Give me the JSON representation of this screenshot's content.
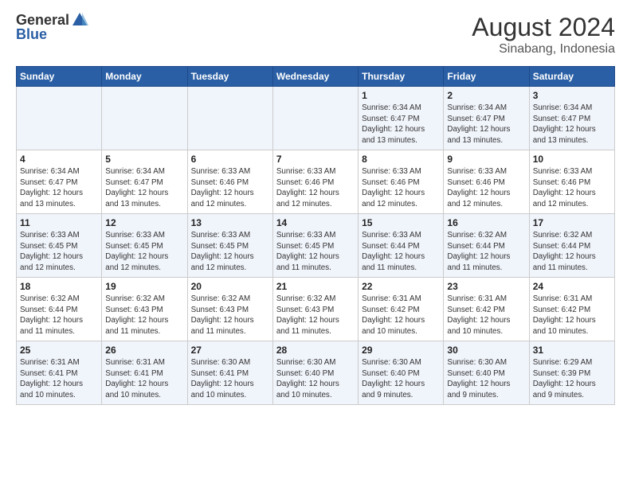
{
  "header": {
    "logo_general": "General",
    "logo_blue": "Blue",
    "month_year": "August 2024",
    "location": "Sinabang, Indonesia"
  },
  "days_of_week": [
    "Sunday",
    "Monday",
    "Tuesday",
    "Wednesday",
    "Thursday",
    "Friday",
    "Saturday"
  ],
  "weeks": [
    [
      {
        "day": "",
        "info": ""
      },
      {
        "day": "",
        "info": ""
      },
      {
        "day": "",
        "info": ""
      },
      {
        "day": "",
        "info": ""
      },
      {
        "day": "1",
        "info": "Sunrise: 6:34 AM\nSunset: 6:47 PM\nDaylight: 12 hours\nand 13 minutes."
      },
      {
        "day": "2",
        "info": "Sunrise: 6:34 AM\nSunset: 6:47 PM\nDaylight: 12 hours\nand 13 minutes."
      },
      {
        "day": "3",
        "info": "Sunrise: 6:34 AM\nSunset: 6:47 PM\nDaylight: 12 hours\nand 13 minutes."
      }
    ],
    [
      {
        "day": "4",
        "info": "Sunrise: 6:34 AM\nSunset: 6:47 PM\nDaylight: 12 hours\nand 13 minutes."
      },
      {
        "day": "5",
        "info": "Sunrise: 6:34 AM\nSunset: 6:47 PM\nDaylight: 12 hours\nand 13 minutes."
      },
      {
        "day": "6",
        "info": "Sunrise: 6:33 AM\nSunset: 6:46 PM\nDaylight: 12 hours\nand 12 minutes."
      },
      {
        "day": "7",
        "info": "Sunrise: 6:33 AM\nSunset: 6:46 PM\nDaylight: 12 hours\nand 12 minutes."
      },
      {
        "day": "8",
        "info": "Sunrise: 6:33 AM\nSunset: 6:46 PM\nDaylight: 12 hours\nand 12 minutes."
      },
      {
        "day": "9",
        "info": "Sunrise: 6:33 AM\nSunset: 6:46 PM\nDaylight: 12 hours\nand 12 minutes."
      },
      {
        "day": "10",
        "info": "Sunrise: 6:33 AM\nSunset: 6:46 PM\nDaylight: 12 hours\nand 12 minutes."
      }
    ],
    [
      {
        "day": "11",
        "info": "Sunrise: 6:33 AM\nSunset: 6:45 PM\nDaylight: 12 hours\nand 12 minutes."
      },
      {
        "day": "12",
        "info": "Sunrise: 6:33 AM\nSunset: 6:45 PM\nDaylight: 12 hours\nand 12 minutes."
      },
      {
        "day": "13",
        "info": "Sunrise: 6:33 AM\nSunset: 6:45 PM\nDaylight: 12 hours\nand 12 minutes."
      },
      {
        "day": "14",
        "info": "Sunrise: 6:33 AM\nSunset: 6:45 PM\nDaylight: 12 hours\nand 11 minutes."
      },
      {
        "day": "15",
        "info": "Sunrise: 6:33 AM\nSunset: 6:44 PM\nDaylight: 12 hours\nand 11 minutes."
      },
      {
        "day": "16",
        "info": "Sunrise: 6:32 AM\nSunset: 6:44 PM\nDaylight: 12 hours\nand 11 minutes."
      },
      {
        "day": "17",
        "info": "Sunrise: 6:32 AM\nSunset: 6:44 PM\nDaylight: 12 hours\nand 11 minutes."
      }
    ],
    [
      {
        "day": "18",
        "info": "Sunrise: 6:32 AM\nSunset: 6:44 PM\nDaylight: 12 hours\nand 11 minutes."
      },
      {
        "day": "19",
        "info": "Sunrise: 6:32 AM\nSunset: 6:43 PM\nDaylight: 12 hours\nand 11 minutes."
      },
      {
        "day": "20",
        "info": "Sunrise: 6:32 AM\nSunset: 6:43 PM\nDaylight: 12 hours\nand 11 minutes."
      },
      {
        "day": "21",
        "info": "Sunrise: 6:32 AM\nSunset: 6:43 PM\nDaylight: 12 hours\nand 11 minutes."
      },
      {
        "day": "22",
        "info": "Sunrise: 6:31 AM\nSunset: 6:42 PM\nDaylight: 12 hours\nand 10 minutes."
      },
      {
        "day": "23",
        "info": "Sunrise: 6:31 AM\nSunset: 6:42 PM\nDaylight: 12 hours\nand 10 minutes."
      },
      {
        "day": "24",
        "info": "Sunrise: 6:31 AM\nSunset: 6:42 PM\nDaylight: 12 hours\nand 10 minutes."
      }
    ],
    [
      {
        "day": "25",
        "info": "Sunrise: 6:31 AM\nSunset: 6:41 PM\nDaylight: 12 hours\nand 10 minutes."
      },
      {
        "day": "26",
        "info": "Sunrise: 6:31 AM\nSunset: 6:41 PM\nDaylight: 12 hours\nand 10 minutes."
      },
      {
        "day": "27",
        "info": "Sunrise: 6:30 AM\nSunset: 6:41 PM\nDaylight: 12 hours\nand 10 minutes."
      },
      {
        "day": "28",
        "info": "Sunrise: 6:30 AM\nSunset: 6:40 PM\nDaylight: 12 hours\nand 10 minutes."
      },
      {
        "day": "29",
        "info": "Sunrise: 6:30 AM\nSunset: 6:40 PM\nDaylight: 12 hours\nand 9 minutes."
      },
      {
        "day": "30",
        "info": "Sunrise: 6:30 AM\nSunset: 6:40 PM\nDaylight: 12 hours\nand 9 minutes."
      },
      {
        "day": "31",
        "info": "Sunrise: 6:29 AM\nSunset: 6:39 PM\nDaylight: 12 hours\nand 9 minutes."
      }
    ]
  ]
}
